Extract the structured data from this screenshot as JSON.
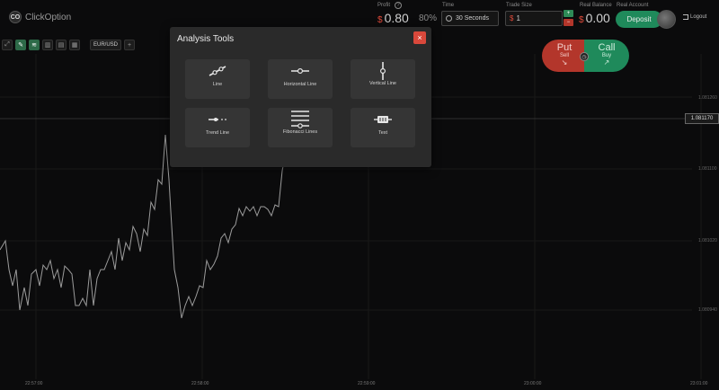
{
  "brand": {
    "name": "ClickOption",
    "mark": "CO"
  },
  "header": {
    "profit": {
      "label": "Profit",
      "currency": "$",
      "value": "0.80",
      "percent": "80%"
    },
    "time": {
      "label": "Time",
      "value": "30 Seconds"
    },
    "trade_size": {
      "label": "Trade Size",
      "currency": "$",
      "value": "1",
      "plus": "+",
      "minus": "−"
    },
    "balance": {
      "label": "Real Balance",
      "currency": "$",
      "value": "0.00"
    },
    "account": {
      "label": "Real Account",
      "deposit": "Deposit"
    },
    "logout": "Logout"
  },
  "toolbar": {
    "pair": "EUR/USD",
    "plus": "+"
  },
  "trade_buttons": {
    "put": {
      "label": "Put",
      "sub": "Sell"
    },
    "call": {
      "label": "Call",
      "sub": "Buy"
    }
  },
  "chart": {
    "current_price": "1.081170",
    "y_ticks": [
      "1.081260",
      "1.081100",
      "1.081020",
      "1.080940"
    ],
    "x_ticks": [
      "22:57:00",
      "22:58:00",
      "22:59:00",
      "23:00:00",
      "23:01:00"
    ],
    "line_color": "#9c9c9c"
  },
  "modal": {
    "title": "Analysis Tools",
    "close": "×",
    "tools": [
      {
        "label": "Line",
        "icon": "line-icon"
      },
      {
        "label": "Horizontal Line",
        "icon": "horizontal-line-icon"
      },
      {
        "label": "Vertical Line",
        "icon": "vertical-line-icon"
      },
      {
        "label": "Trend Line",
        "icon": "trend-line-icon"
      },
      {
        "label": "Fibonacci Lines",
        "icon": "fibonacci-lines-icon"
      },
      {
        "label": "Text",
        "icon": "text-icon"
      }
    ]
  },
  "colors": {
    "accent_green": "#1f8a5b",
    "accent_red": "#b3362b"
  }
}
